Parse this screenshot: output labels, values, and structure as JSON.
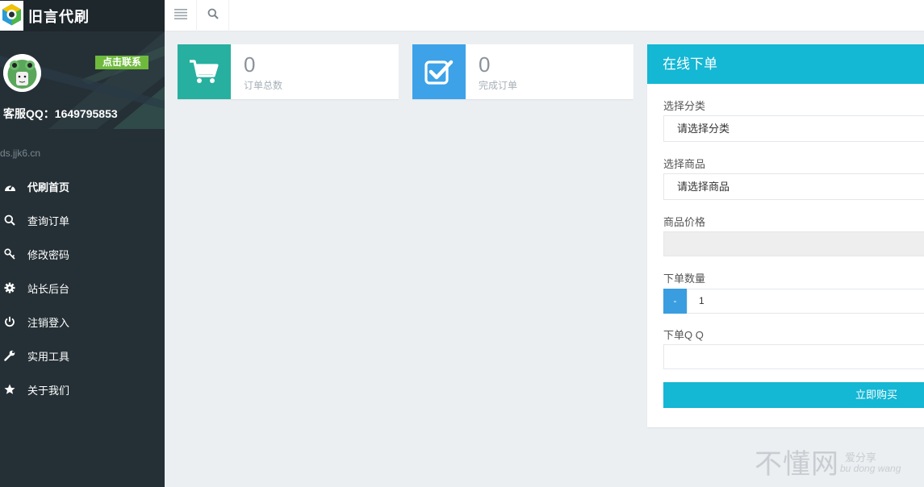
{
  "brand": {
    "title": "旧言代刷"
  },
  "user": {
    "contact_label": "点击联系",
    "kf_qq": "客服QQ：1649795853"
  },
  "site_url": "ds.jjk6.cn",
  "nav": [
    {
      "label": "代刷首页",
      "icon": "dashboard-icon",
      "active": true
    },
    {
      "label": "查询订单",
      "icon": "search-icon"
    },
    {
      "label": "修改密码",
      "icon": "key-icon"
    },
    {
      "label": "站长后台",
      "icon": "gear-icon"
    },
    {
      "label": "注销登入",
      "icon": "power-icon"
    },
    {
      "label": "实用工具",
      "icon": "wrench-icon"
    },
    {
      "label": "关于我们",
      "icon": "star-icon"
    }
  ],
  "stats": [
    {
      "value": "0",
      "caption": "订单总数",
      "icon": "cart-icon",
      "color": "#27b0a0"
    },
    {
      "value": "0",
      "caption": "完成订单",
      "icon": "check-square-icon",
      "color": "#3da2e8"
    }
  ],
  "order": {
    "title": "在线下单",
    "category_label": "选择分类",
    "category_value": "请选择分类",
    "product_label": "选择商品",
    "product_value": "请选择商品",
    "price_label": "商品价格",
    "price_value": "",
    "qty_label": "下单数量",
    "qty_minus": "-",
    "qty_value": "1",
    "qq_label": "下单Q Q",
    "qq_value": "",
    "buy_label": "立即购买"
  },
  "watermark": {
    "big": "不懂网",
    "small1": "爱分享",
    "small2": "bu dong wang"
  },
  "colors": {
    "sidebar": "#253036",
    "accent": "#14b7d4",
    "green": "#6fba3d"
  }
}
